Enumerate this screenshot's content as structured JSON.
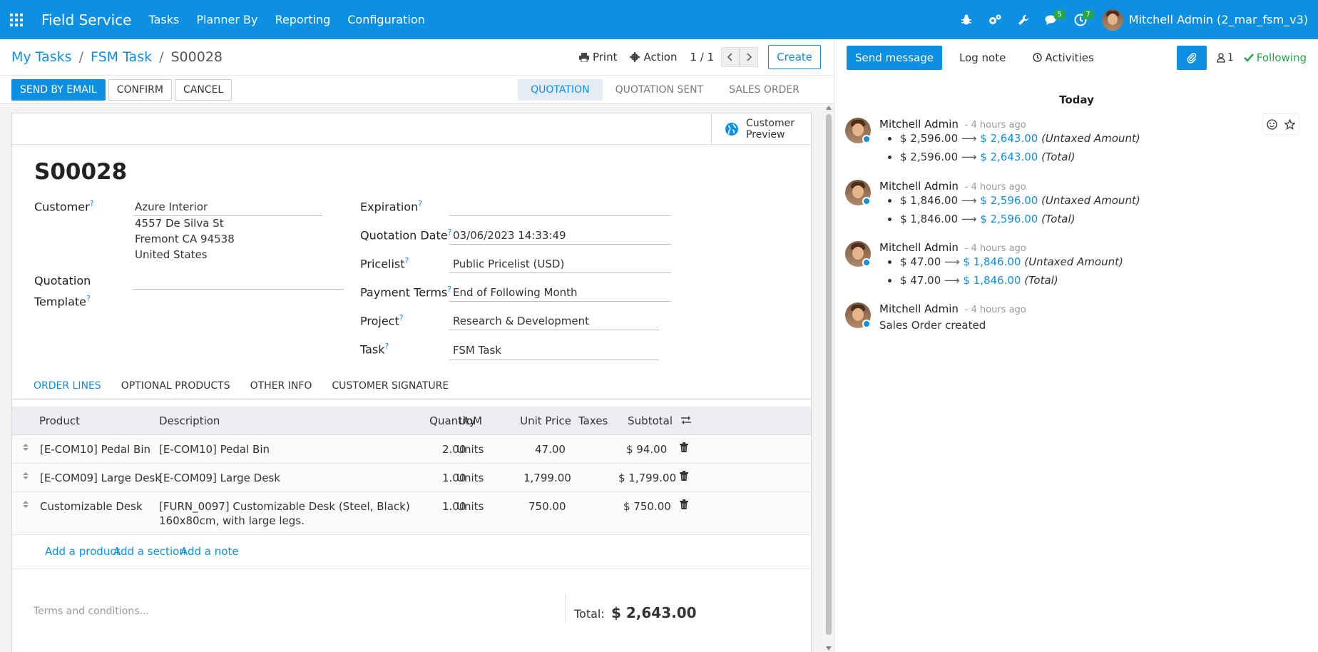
{
  "navbar": {
    "app_name": "Field Service",
    "menus": [
      "Tasks",
      "Planner By",
      "Reporting",
      "Configuration"
    ],
    "messages_count": "5",
    "activities_count": "7",
    "user_name": "Mitchell Admin (2_mar_fsm_v3)"
  },
  "breadcrumb": {
    "items": [
      "My Tasks",
      "FSM Task"
    ],
    "current": "S00028"
  },
  "control_panel": {
    "print_label": "Print",
    "action_label": "Action",
    "pager_value": "1 / 1",
    "create_label": "Create"
  },
  "buttons": {
    "send_by_email": "SEND BY EMAIL",
    "confirm": "CONFIRM",
    "cancel": "CANCEL"
  },
  "statusbar": [
    "QUOTATION",
    "QUOTATION SENT",
    "SALES ORDER"
  ],
  "customer_preview": "Customer Preview",
  "form": {
    "title": "S00028",
    "customer_label": "Customer",
    "customer_name": "Azure Interior",
    "address_line1": "4557 De Silva St",
    "address_line2": "Fremont CA 94538",
    "address_line3": "United States",
    "template_label_1": "Quotation",
    "template_label_2": "Template",
    "expiration_label": "Expiration",
    "expiration_value": "",
    "quotation_date_label": "Quotation Date",
    "quotation_date_value": "03/06/2023 14:33:49",
    "pricelist_label": "Pricelist",
    "pricelist_value": "Public Pricelist (USD)",
    "payment_terms_label": "Payment Terms",
    "payment_terms_value": "End of Following Month",
    "project_label": "Project",
    "project_value": "Research & Development",
    "task_label": "Task",
    "task_value": "FSM Task",
    "help_mark": "?"
  },
  "tabs": [
    "ORDER LINES",
    "OPTIONAL PRODUCTS",
    "OTHER INFO",
    "CUSTOMER SIGNATURE"
  ],
  "order_lines": {
    "columns": [
      "Product",
      "Description",
      "Quantity",
      "UoM",
      "Unit Price",
      "Taxes",
      "Subtotal"
    ],
    "rows": [
      {
        "product": "[E-COM10] Pedal Bin",
        "desc1": "[E-COM10] Pedal Bin",
        "desc2": "",
        "qty": "2.00",
        "uom": "Units",
        "price": "47.00",
        "subtotal": "$ 94.00"
      },
      {
        "product": "[E-COM09] Large Desk",
        "desc1": "[E-COM09] Large Desk",
        "desc2": "",
        "qty": "1.00",
        "uom": "Units",
        "price": "1,799.00",
        "subtotal": "$ 1,799.00"
      },
      {
        "product": "Customizable Desk",
        "desc1": "[FURN_0097] Customizable Desk (Steel, Black)",
        "desc2": "160x80cm, with large legs.",
        "qty": "1.00",
        "uom": "Units",
        "price": "750.00",
        "subtotal": "$ 750.00"
      }
    ],
    "add_product": "Add a product",
    "add_section": "Add a section",
    "add_note": "Add a note"
  },
  "terms_placeholder": "Terms and conditions...",
  "total": {
    "label": "Total:",
    "value": "$ 2,643.00"
  },
  "chatter": {
    "send_message": "Send message",
    "log_note": "Log note",
    "activities": "Activities",
    "followers_count": "1",
    "following": "Following",
    "date_separator": "Today",
    "messages": [
      {
        "author": "Mitchell Admin",
        "time": "- 4 hours ago",
        "changes": [
          {
            "old": "$ 2,596.00",
            "new": "$ 2,643.00",
            "field": "(Untaxed Amount)"
          },
          {
            "old": "$ 2,596.00",
            "new": "$ 2,643.00",
            "field": "(Total)"
          }
        ]
      },
      {
        "author": "Mitchell Admin",
        "time": "- 4 hours ago",
        "changes": [
          {
            "old": "$ 1,846.00",
            "new": "$ 2,596.00",
            "field": "(Untaxed Amount)"
          },
          {
            "old": "$ 1,846.00",
            "new": "$ 2,596.00",
            "field": "(Total)"
          }
        ]
      },
      {
        "author": "Mitchell Admin",
        "time": "- 4 hours ago",
        "changes": [
          {
            "old": "$ 47.00",
            "new": "$ 1,846.00",
            "field": "(Untaxed Amount)"
          },
          {
            "old": "$ 47.00",
            "new": "$ 1,846.00",
            "field": "(Total)"
          }
        ]
      },
      {
        "author": "Mitchell Admin",
        "time": "- 4 hours ago",
        "body": "Sales Order created"
      }
    ]
  },
  "colors": {
    "primary": "#0d8fe3",
    "success": "#28a745",
    "navbar": "#0d8fe3"
  }
}
